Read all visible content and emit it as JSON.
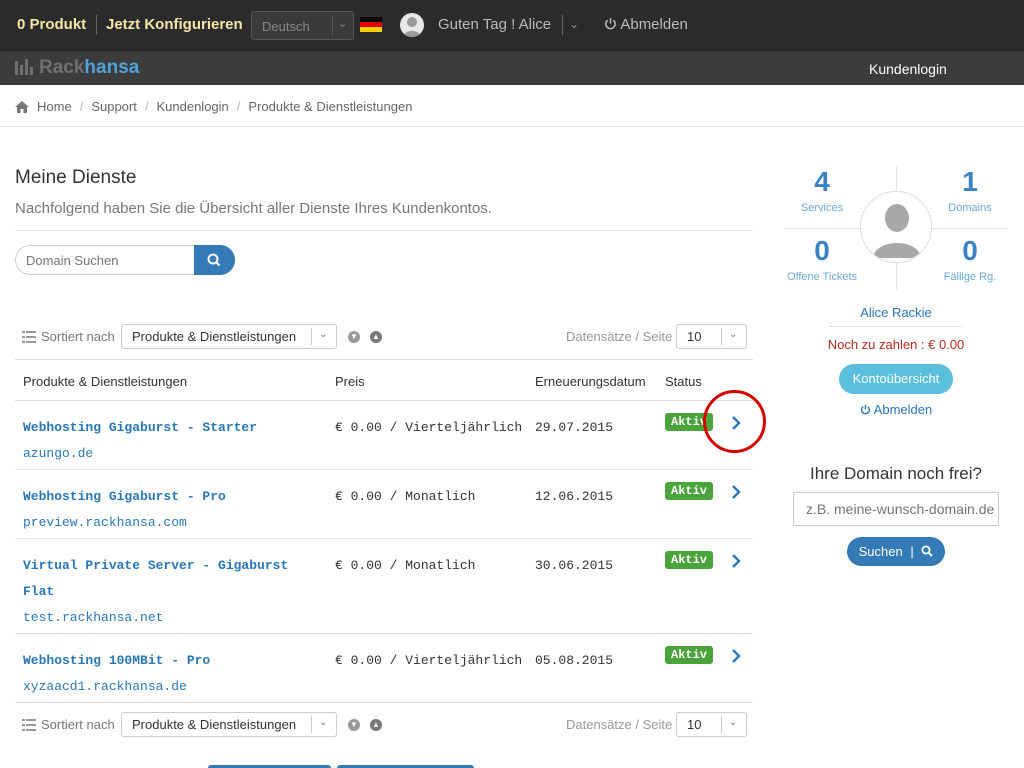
{
  "topbar": {
    "cart": "0 Produkt",
    "configure": "Jetzt Konfigurieren",
    "language": "Deutsch",
    "greeting": "Guten Tag ! Alice",
    "logout": "Abmelden"
  },
  "navbar": {
    "logo_rack": "Rack",
    "logo_hansa": "hansa",
    "customer_login": "Kundenlogin"
  },
  "breadcrumb": [
    "Home",
    "Support",
    "Kundenlogin",
    "Produkte & Dienstleistungen"
  ],
  "main": {
    "title": "Meine Dienste",
    "subtitle": "Nachfolgend haben Sie die Übersicht aller Dienste Ihres Kundenkontos.",
    "search_placeholder": "Domain Suchen",
    "sort_label": "Sortiert nach",
    "sort_value": "Produkte & Dienstleistungen",
    "per_page_label": "Datensätze / Seite",
    "per_page_value": "10",
    "columns": [
      "Produkte & Dienstleistungen",
      "Preis",
      "Erneuerungsdatum",
      "Status"
    ],
    "rows": [
      {
        "product": "Webhosting Gigaburst - Starter",
        "domain": "azungo.de",
        "price": "€ 0.00 / Vierteljährlich",
        "date": "29.07.2015",
        "status": "Aktiv"
      },
      {
        "product": "Webhosting Gigaburst - Pro",
        "domain": "preview.rackhansa.com",
        "price": "€ 0.00 / Monatlich",
        "date": "12.06.2015",
        "status": "Aktiv"
      },
      {
        "product": "Virtual Private Server - Gigaburst Flat",
        "domain": "test.rackhansa.net",
        "price": "€ 0.00 / Monatlich",
        "date": "30.06.2015",
        "status": "Aktiv"
      },
      {
        "product": "Webhosting 100MBit - Pro",
        "domain": "xyzaacd1.rackhansa.de",
        "price": "€ 0.00 / Vierteljährlich",
        "date": "05.08.2015",
        "status": "Aktiv"
      }
    ]
  },
  "sidebar": {
    "stats": [
      {
        "value": "4",
        "label": "Services"
      },
      {
        "value": "1",
        "label": "Domains"
      },
      {
        "value": "0",
        "label": "Offene Tickets"
      },
      {
        "value": "0",
        "label": "Fällige Rg."
      }
    ],
    "user_name": "Alice Rackie",
    "due": "Noch zu zahlen : € 0.00",
    "account_button": "Kontoübersicht",
    "logout": "Abmelden",
    "domain_title": "Ihre Domain noch frei?",
    "domain_placeholder": "z.B. meine-wunsch-domain.de",
    "domain_button": "Suchen"
  },
  "colors": {
    "accent": "#337ab7",
    "link": "#2a77b8",
    "status_active": "#4aa33b",
    "topbar": "#2b2b2b",
    "navbar": "#3c3c3c",
    "highlight": "#d40000"
  }
}
